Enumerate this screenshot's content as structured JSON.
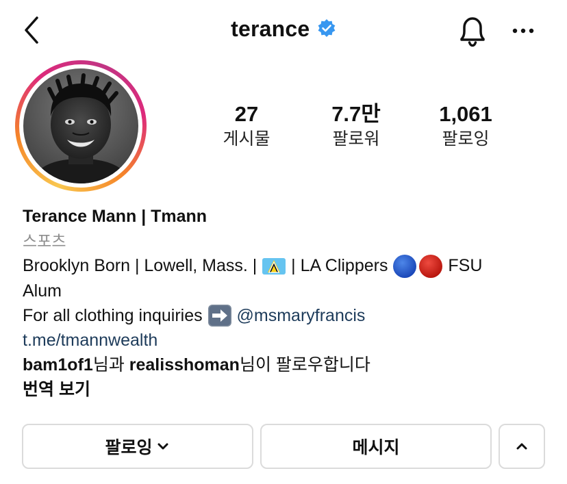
{
  "header": {
    "username": "terance",
    "back_icon": "chevron-left-icon",
    "verified_icon": "verified-badge-icon",
    "bell_icon": "bell-icon",
    "more_icon": "more-horizontal-icon"
  },
  "stats": [
    {
      "value": "27",
      "label": "게시물"
    },
    {
      "value": "7.7만",
      "label": "팔로워"
    },
    {
      "value": "1,061",
      "label": "팔로잉"
    }
  ],
  "bio": {
    "name": "Terance Mann | Tmann",
    "category": "스포츠",
    "line1_a": "Brooklyn Born | Lowell, Mass. | ",
    "line1_b": " | LA Clippers ",
    "line1_c": " FSU",
    "line2": "Alum",
    "line3_a": "For all clothing inquiries ",
    "mention": "@msmaryfrancis",
    "website": "t.me/tmannwealth",
    "followed_by_user1": "bam1of1",
    "followed_by_mid": "님과 ",
    "followed_by_user2": "realisshoman",
    "followed_by_end": "님이 팔로우합니다",
    "translate": "번역 보기"
  },
  "actions": {
    "following_label": "팔로잉",
    "message_label": "메시지"
  },
  "colors": {
    "verified": "#3897f0",
    "link": "#1d3b5a",
    "muted": "#8e8e8e",
    "border": "#dbdbdb"
  }
}
